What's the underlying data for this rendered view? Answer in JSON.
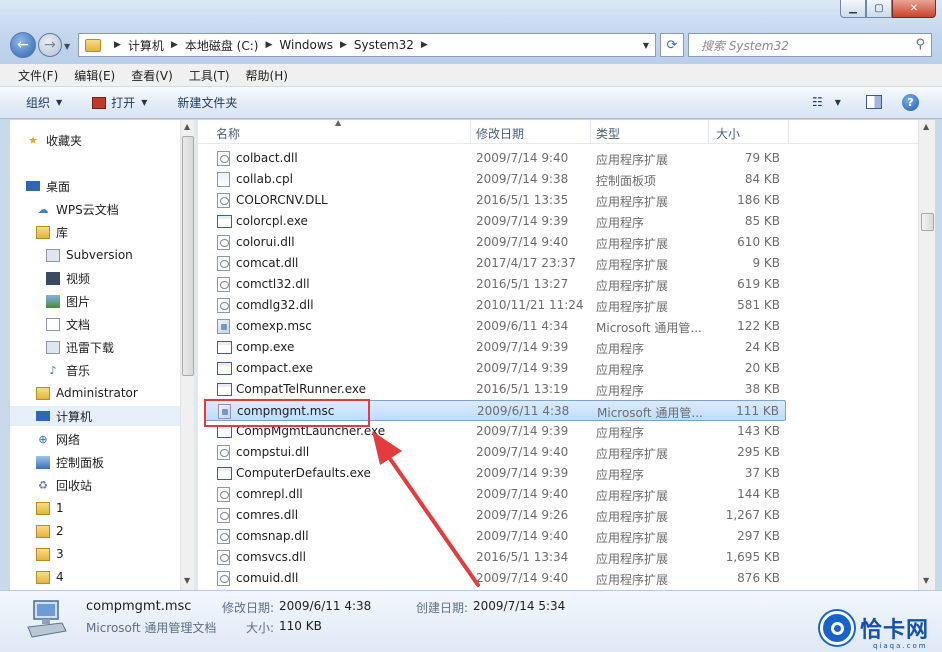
{
  "window": {
    "caption_buttons": [
      "minimize",
      "maximize",
      "close"
    ]
  },
  "address": {
    "crumbs": [
      "计算机",
      "本地磁盘 (C:)",
      "Windows",
      "System32"
    ]
  },
  "search": {
    "placeholder": "搜索 System32"
  },
  "menu": [
    "文件(F)",
    "编辑(E)",
    "查看(V)",
    "工具(T)",
    "帮助(H)"
  ],
  "toolbar": {
    "organize": "组织",
    "open": "打开",
    "new_folder": "新建文件夹"
  },
  "nav": [
    {
      "label": "收藏夹",
      "icon": "star-icon"
    },
    {
      "label": "桌面",
      "icon": "desktop-icon"
    },
    {
      "label": "WPS云文档",
      "icon": "cloud-icon"
    },
    {
      "label": "库",
      "icon": "library-icon"
    },
    {
      "label": "Subversion",
      "icon": "library-folder-icon"
    },
    {
      "label": "视频",
      "icon": "video-icon"
    },
    {
      "label": "图片",
      "icon": "picture-icon"
    },
    {
      "label": "文档",
      "icon": "document-icon"
    },
    {
      "label": "迅雷下载",
      "icon": "download-icon"
    },
    {
      "label": "音乐",
      "icon": "music-icon"
    },
    {
      "label": "Administrator",
      "icon": "user-folder-icon"
    },
    {
      "label": "计算机",
      "icon": "computer-icon"
    },
    {
      "label": "网络",
      "icon": "network-icon"
    },
    {
      "label": "控制面板",
      "icon": "control-panel-icon"
    },
    {
      "label": "回收站",
      "icon": "recycle-bin-icon"
    },
    {
      "label": "1",
      "icon": "folder-icon"
    },
    {
      "label": "2",
      "icon": "folder-icon"
    },
    {
      "label": "3",
      "icon": "folder-icon"
    },
    {
      "label": "4",
      "icon": "folder-icon"
    }
  ],
  "columns": {
    "name": "名称",
    "date": "修改日期",
    "type": "类型",
    "size": "大小"
  },
  "files": [
    {
      "name": "colbact.dll",
      "date": "2009/7/14 9:40",
      "type": "应用程序扩展",
      "size": "79 KB",
      "kind": "dll"
    },
    {
      "name": "collab.cpl",
      "date": "2009/7/14 9:38",
      "type": "控制面板项",
      "size": "84 KB",
      "kind": "cpl"
    },
    {
      "name": "COLORCNV.DLL",
      "date": "2016/5/1 13:35",
      "type": "应用程序扩展",
      "size": "186 KB",
      "kind": "dll"
    },
    {
      "name": "colorcpl.exe",
      "date": "2009/7/14 9:39",
      "type": "应用程序",
      "size": "85 KB",
      "kind": "exe"
    },
    {
      "name": "colorui.dll",
      "date": "2009/7/14 9:40",
      "type": "应用程序扩展",
      "size": "610 KB",
      "kind": "dll"
    },
    {
      "name": "comcat.dll",
      "date": "2017/4/17 23:37",
      "type": "应用程序扩展",
      "size": "9 KB",
      "kind": "dll"
    },
    {
      "name": "comctl32.dll",
      "date": "2016/5/1 13:27",
      "type": "应用程序扩展",
      "size": "619 KB",
      "kind": "dll"
    },
    {
      "name": "comdlg32.dll",
      "date": "2010/11/21 11:24",
      "type": "应用程序扩展",
      "size": "581 KB",
      "kind": "dll"
    },
    {
      "name": "comexp.msc",
      "date": "2009/6/11 4:34",
      "type": "Microsoft 通用管...",
      "size": "122 KB",
      "kind": "msc"
    },
    {
      "name": "comp.exe",
      "date": "2009/7/14 9:39",
      "type": "应用程序",
      "size": "24 KB",
      "kind": "exe"
    },
    {
      "name": "compact.exe",
      "date": "2009/7/14 9:39",
      "type": "应用程序",
      "size": "20 KB",
      "kind": "exe"
    },
    {
      "name": "CompatTelRunner.exe",
      "date": "2016/5/1 13:19",
      "type": "应用程序",
      "size": "38 KB",
      "kind": "exe"
    },
    {
      "name": "compmgmt.msc",
      "date": "2009/6/11 4:38",
      "type": "Microsoft 通用管...",
      "size": "111 KB",
      "kind": "msc",
      "selected": true
    },
    {
      "name": "CompMgmtLauncher.exe",
      "date": "2009/7/14 9:39",
      "type": "应用程序",
      "size": "143 KB",
      "kind": "exe"
    },
    {
      "name": "compstui.dll",
      "date": "2009/7/14 9:40",
      "type": "应用程序扩展",
      "size": "295 KB",
      "kind": "dll"
    },
    {
      "name": "ComputerDefaults.exe",
      "date": "2009/7/14 9:39",
      "type": "应用程序",
      "size": "37 KB",
      "kind": "exe"
    },
    {
      "name": "comrepl.dll",
      "date": "2009/7/14 9:40",
      "type": "应用程序扩展",
      "size": "144 KB",
      "kind": "dll"
    },
    {
      "name": "comres.dll",
      "date": "2009/7/14 9:26",
      "type": "应用程序扩展",
      "size": "1,267 KB",
      "kind": "dll"
    },
    {
      "name": "comsnap.dll",
      "date": "2009/7/14 9:40",
      "type": "应用程序扩展",
      "size": "297 KB",
      "kind": "dll"
    },
    {
      "name": "comsvcs.dll",
      "date": "2016/5/1 13:34",
      "type": "应用程序扩展",
      "size": "1,695 KB",
      "kind": "dll"
    },
    {
      "name": "comuid.dll",
      "date": "2009/7/14 9:40",
      "type": "应用程序扩展",
      "size": "876 KB",
      "kind": "dll"
    }
  ],
  "details": {
    "name": "compmgmt.msc",
    "type": "Microsoft 通用管理文档",
    "modified_label": "修改日期:",
    "modified": "2009/6/11 4:38",
    "created_label": "创建日期:",
    "created": "2009/7/14 5:34",
    "size_label": "大小:",
    "size": "110 KB"
  },
  "watermark": {
    "text": "恰卡网",
    "sub": "qiaqa.com"
  },
  "colors": {
    "highlight_box": "#e33c3c",
    "selection": "#c1dcfc",
    "accent": "#1763c8"
  }
}
